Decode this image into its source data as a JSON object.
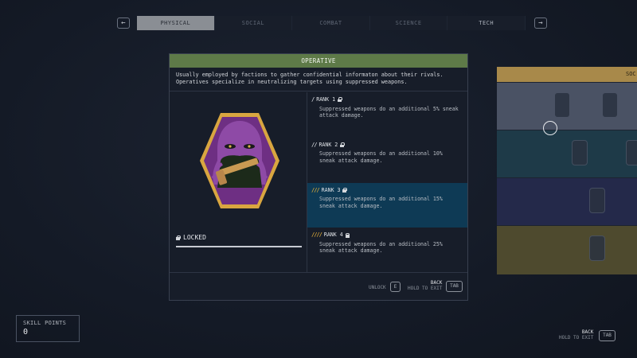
{
  "nav": {
    "prev_glyph": "←",
    "next_glyph": "→",
    "tabs": [
      {
        "label": "PHYSICAL"
      },
      {
        "label": "SOCIAL"
      },
      {
        "label": "COMBAT"
      },
      {
        "label": "SCIENCE"
      },
      {
        "label": "TECH"
      }
    ],
    "active_tab": "PHYSICAL"
  },
  "panel": {
    "title": "OPERATIVE",
    "description": "Usually employed by factions to gather confidential informaton about their rivals. Operatives specialize in neutralizing targets using suppressed weapons.",
    "status": "LOCKED",
    "ranks": [
      {
        "title": "RANK 1",
        "pips": "/",
        "desc": "Suppressed weapons do an additional 5% sneak attack damage."
      },
      {
        "title": "RANK 2",
        "pips": "//",
        "desc": "Suppressed weapons do an additional 10% sneak attack damage."
      },
      {
        "title": "RANK 3",
        "pips": "///",
        "desc": "Suppressed weapons do an additional 15% sneak attack damage."
      },
      {
        "title": "RANK 4",
        "pips": "////",
        "desc": "Suppressed weapons do an additional 25% sneak attack damage."
      }
    ],
    "footer": {
      "unlock_label": "UNLOCK",
      "unlock_key": "E",
      "back_label": "BACK",
      "hold_label": "HOLD TO EXIT",
      "back_key": "TAB"
    }
  },
  "side_panel": {
    "header": "SOC"
  },
  "skill_points": {
    "label": "SKILL POINTS",
    "value": "0"
  },
  "global_footer": {
    "back_label": "BACK",
    "hold_label": "HOLD TO EXIT",
    "key": "TAB"
  },
  "colors": {
    "header_green": "#5e7a48",
    "active_rank": "#0e3a55",
    "rank_gold": "#d8a83a",
    "badge_gold": "#d9a640",
    "badge_purple": "#7a3a8e"
  }
}
